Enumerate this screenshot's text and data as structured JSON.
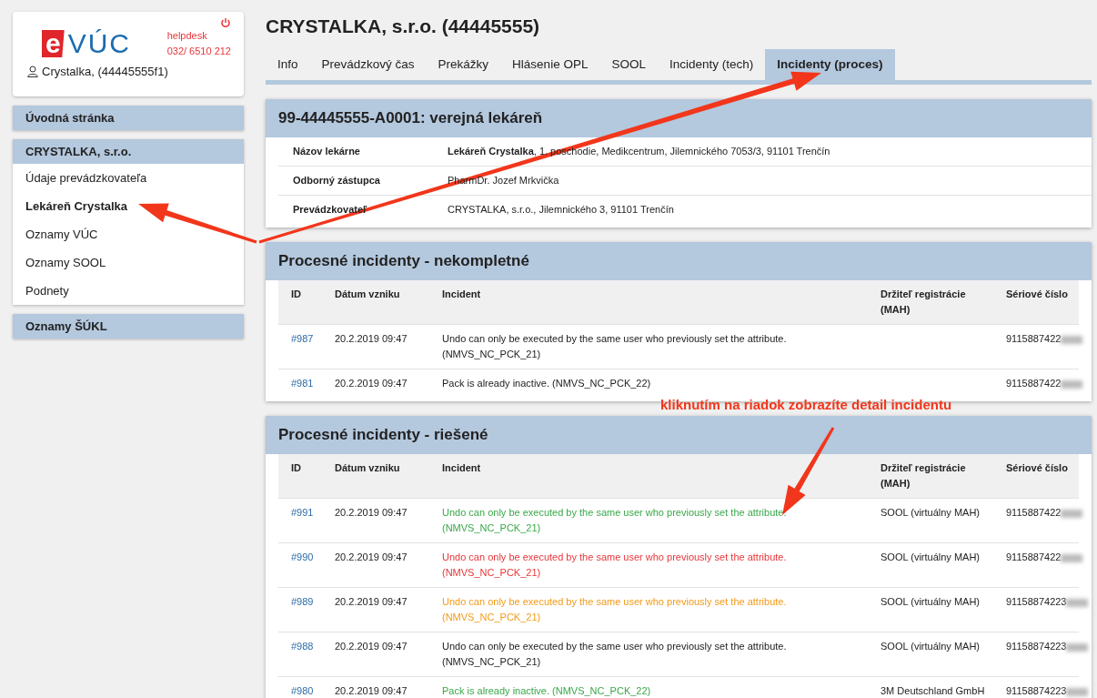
{
  "brand": {
    "logo_letter": "e",
    "logo_text": "VÚC",
    "helpdesk_label": "helpdesk",
    "helpdesk_phone": "032/ 6510 212",
    "user": "Crystalka, (44445555f1)"
  },
  "sidebar": [
    {
      "title": "Úvodná stránka"
    },
    {
      "title": "CRYSTALKA, s.r.o.",
      "items": [
        {
          "label": "Údaje prevádzkovateľa",
          "selected": false
        },
        {
          "label": "Lekáreň Crystalka",
          "selected": true
        },
        {
          "label": "Oznamy VÚC",
          "selected": false
        },
        {
          "label": "Oznamy SOOL",
          "selected": false
        },
        {
          "label": "Podnety",
          "selected": false
        }
      ]
    },
    {
      "title": "Oznamy ŠÚKL"
    }
  ],
  "page_title": "CRYSTALKA, s.r.o. (44445555)",
  "tabs": [
    {
      "label": "Info",
      "selected": false
    },
    {
      "label": "Prevádzkový čas",
      "selected": false
    },
    {
      "label": "Prekážky",
      "selected": false
    },
    {
      "label": "Hlásenie OPL",
      "selected": false
    },
    {
      "label": "SOOL",
      "selected": false
    },
    {
      "label": "Incidenty (tech)",
      "selected": false
    },
    {
      "label": "Incidenty (proces)",
      "selected": true
    }
  ],
  "pharmacy": {
    "title": "99-44445555-A0001: verejná lekáreň",
    "rows": [
      {
        "label": "Názov lekárne",
        "value": "**Lekáreň Crystalka**, 1. poschodie, Medikcentrum, Jilemnického 7053/3, 91101 Trenčín"
      },
      {
        "label": "Odborný zástupca",
        "value": "PharmDr. Jozef Mrkvička"
      },
      {
        "label": "Prevádzkovateľ",
        "value": "CRYSTALKA, s.r.o., Jilemnického 3, 91101 Trenčín"
      }
    ]
  },
  "incident_tables": [
    {
      "title": "Procesné incidenty - nekompletné",
      "columns": [
        "ID",
        "Dátum vzniku",
        "Incident",
        "Držiteľ registrácie (MAH)",
        "Sériové číslo"
      ],
      "rows": [
        {
          "id": "#987",
          "date": "20.2.2019 09:47",
          "incident": "Undo can only be executed by the same user who previously set the attribute. (NMVS_NC_PCK_21)",
          "color": "#222222",
          "serial": "9115887422"
        },
        {
          "id": "#981",
          "date": "20.2.2019 09:47",
          "incident": "Pack is already inactive. (NMVS_NC_PCK_22)",
          "color": "#222222",
          "serial": "9115887422"
        }
      ]
    },
    {
      "title": "Procesné incidenty - riešené",
      "columns": [
        "ID",
        "Dátum vzniku",
        "Incident",
        "Držiteľ registrácie (MAH)",
        "Sériové číslo"
      ],
      "rows": [
        {
          "id": "#991",
          "date": "20.2.2019 09:47",
          "incident": "Undo can only be executed by the same user who previously set the attribute. (NMVS_NC_PCK_21)",
          "color": "#3aa84a",
          "mah": "SOOL (virtuálny MAH)",
          "serial": "9115887422"
        },
        {
          "id": "#990",
          "date": "20.2.2019 09:47",
          "incident": "Undo can only be executed by the same user who previously set the attribute. (NMVS_NC_PCK_21)",
          "color": "#e8363a",
          "mah": "SOOL (virtuálny MAH)",
          "serial": "9115887422"
        },
        {
          "id": "#989",
          "date": "20.2.2019 09:47",
          "incident": "Undo can only be executed by the same user who previously set the attribute. (NMVS_NC_PCK_21)",
          "color": "#f29a18",
          "mah": "SOOL (virtuálny MAH)",
          "serial": "91158874223"
        },
        {
          "id": "#988",
          "date": "20.2.2019 09:47",
          "incident": "Undo can only be executed by the same user who previously set the attribute. (NMVS_NC_PCK_21)",
          "color": "#222222",
          "mah": "SOOL (virtuálny MAH)",
          "serial": "91158874223"
        },
        {
          "id": "#980",
          "date": "20.2.2019 09:47",
          "incident": "Pack is already inactive. (NMVS_NC_PCK_22)",
          "color": "#3aa84a",
          "mah": "3M Deutschland GmbH",
          "serial": "91158874223"
        }
      ]
    }
  ],
  "annotation": "kliknutím na riadok zobrazíte detail incidentu"
}
